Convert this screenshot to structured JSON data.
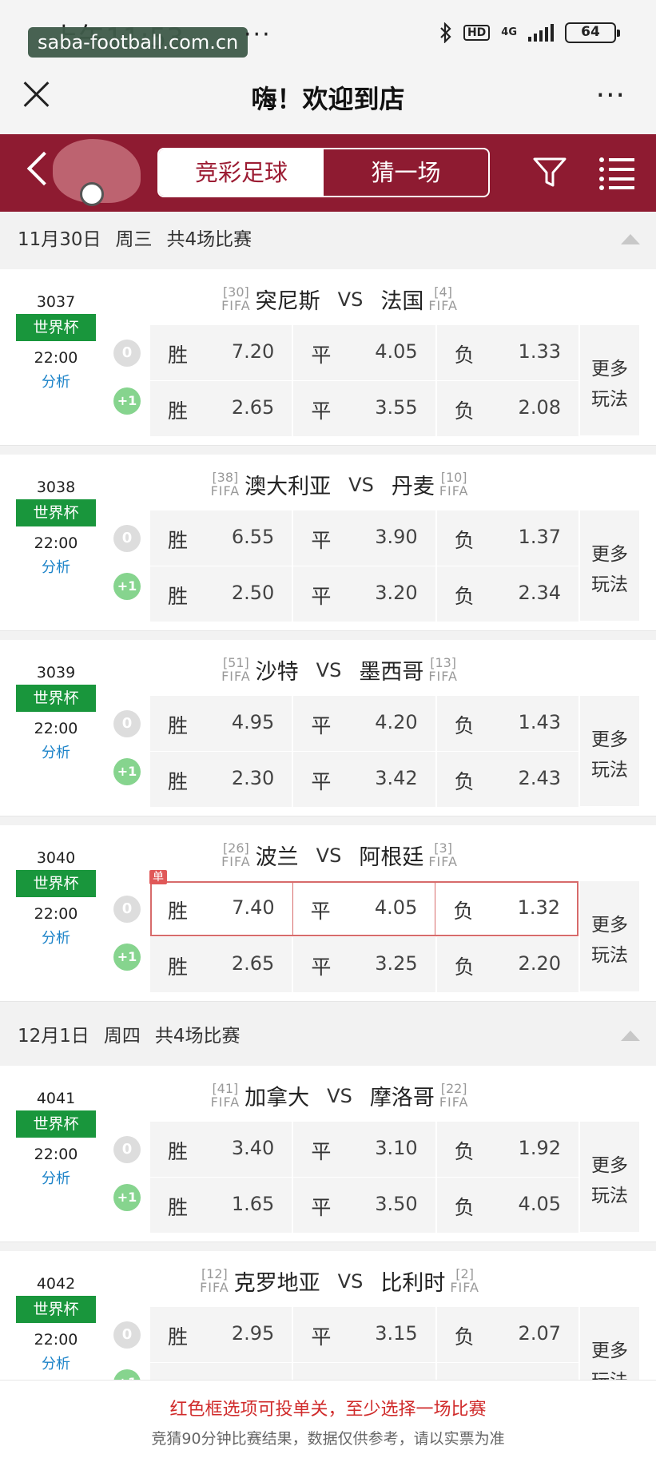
{
  "status": {
    "time": "上午11:53",
    "watermark": "saba-football.com.cn",
    "dots": "···",
    "hd": "HD",
    "net": "4G",
    "battery": "64"
  },
  "title": {
    "text": "嗨！欢迎到店",
    "more": "···"
  },
  "tabs": [
    {
      "label": "竞彩足球",
      "active": true
    },
    {
      "label": "猜一场",
      "active": false
    }
  ],
  "days": [
    {
      "date": "11月30日",
      "weekday": "周三",
      "count": "共4场比赛"
    },
    {
      "date": "12月1日",
      "weekday": "周四",
      "count": "共4场比赛"
    }
  ],
  "labels": {
    "win": "胜",
    "draw": "平",
    "lose": "负",
    "more_play": [
      "更多",
      "玩法"
    ],
    "fifa": "FIFA",
    "vs": "VS",
    "analysis": "分析",
    "single": "单",
    "hc0": "0",
    "hc1": "+1"
  },
  "matches": [
    {
      "num": "3037",
      "league": "世界杯",
      "time": "22:00",
      "home": "突尼斯",
      "home_rank": "[30]",
      "away": "法国",
      "away_rank": "[4]",
      "odds0": [
        "7.20",
        "4.05",
        "1.33"
      ],
      "odds1": [
        "2.65",
        "3.55",
        "2.08"
      ]
    },
    {
      "num": "3038",
      "league": "世界杯",
      "time": "22:00",
      "home": "澳大利亚",
      "home_rank": "[38]",
      "away": "丹麦",
      "away_rank": "[10]",
      "odds0": [
        "6.55",
        "3.90",
        "1.37"
      ],
      "odds1": [
        "2.50",
        "3.20",
        "2.34"
      ]
    },
    {
      "num": "3039",
      "league": "世界杯",
      "time": "22:00",
      "home": "沙特",
      "home_rank": "[51]",
      "away": "墨西哥",
      "away_rank": "[13]",
      "odds0": [
        "4.95",
        "4.20",
        "1.43"
      ],
      "odds1": [
        "2.30",
        "3.42",
        "2.43"
      ]
    },
    {
      "num": "3040",
      "league": "世界杯",
      "time": "22:00",
      "home": "波兰",
      "home_rank": "[26]",
      "away": "阿根廷",
      "away_rank": "[3]",
      "odds0": [
        "7.40",
        "4.05",
        "1.32"
      ],
      "odds1": [
        "2.65",
        "3.25",
        "2.20"
      ],
      "single": true
    },
    {
      "num": "4041",
      "league": "世界杯",
      "time": "22:00",
      "home": "加拿大",
      "home_rank": "[41]",
      "away": "摩洛哥",
      "away_rank": "[22]",
      "odds0": [
        "3.40",
        "3.10",
        "1.92"
      ],
      "odds1": [
        "1.65",
        "3.50",
        "4.05"
      ]
    },
    {
      "num": "4042",
      "league": "世界杯",
      "time": "22:00",
      "home": "克罗地亚",
      "home_rank": "[12]",
      "away": "比利时",
      "away_rank": "[2]",
      "odds0": [
        "2.95",
        "3.15",
        "2.07"
      ],
      "odds1": [
        "",
        "",
        ""
      ]
    }
  ],
  "footer": {
    "line1": "红色框选项可投单关，至少选择一场比赛",
    "line2": "竞猜90分钟比赛结果，数据仅供参考，请以实票为准"
  },
  "colors": {
    "banner": "#8e1b31",
    "league": "#19963c",
    "analysis": "#1a82c8",
    "footer_alert": "#d02b2b"
  }
}
